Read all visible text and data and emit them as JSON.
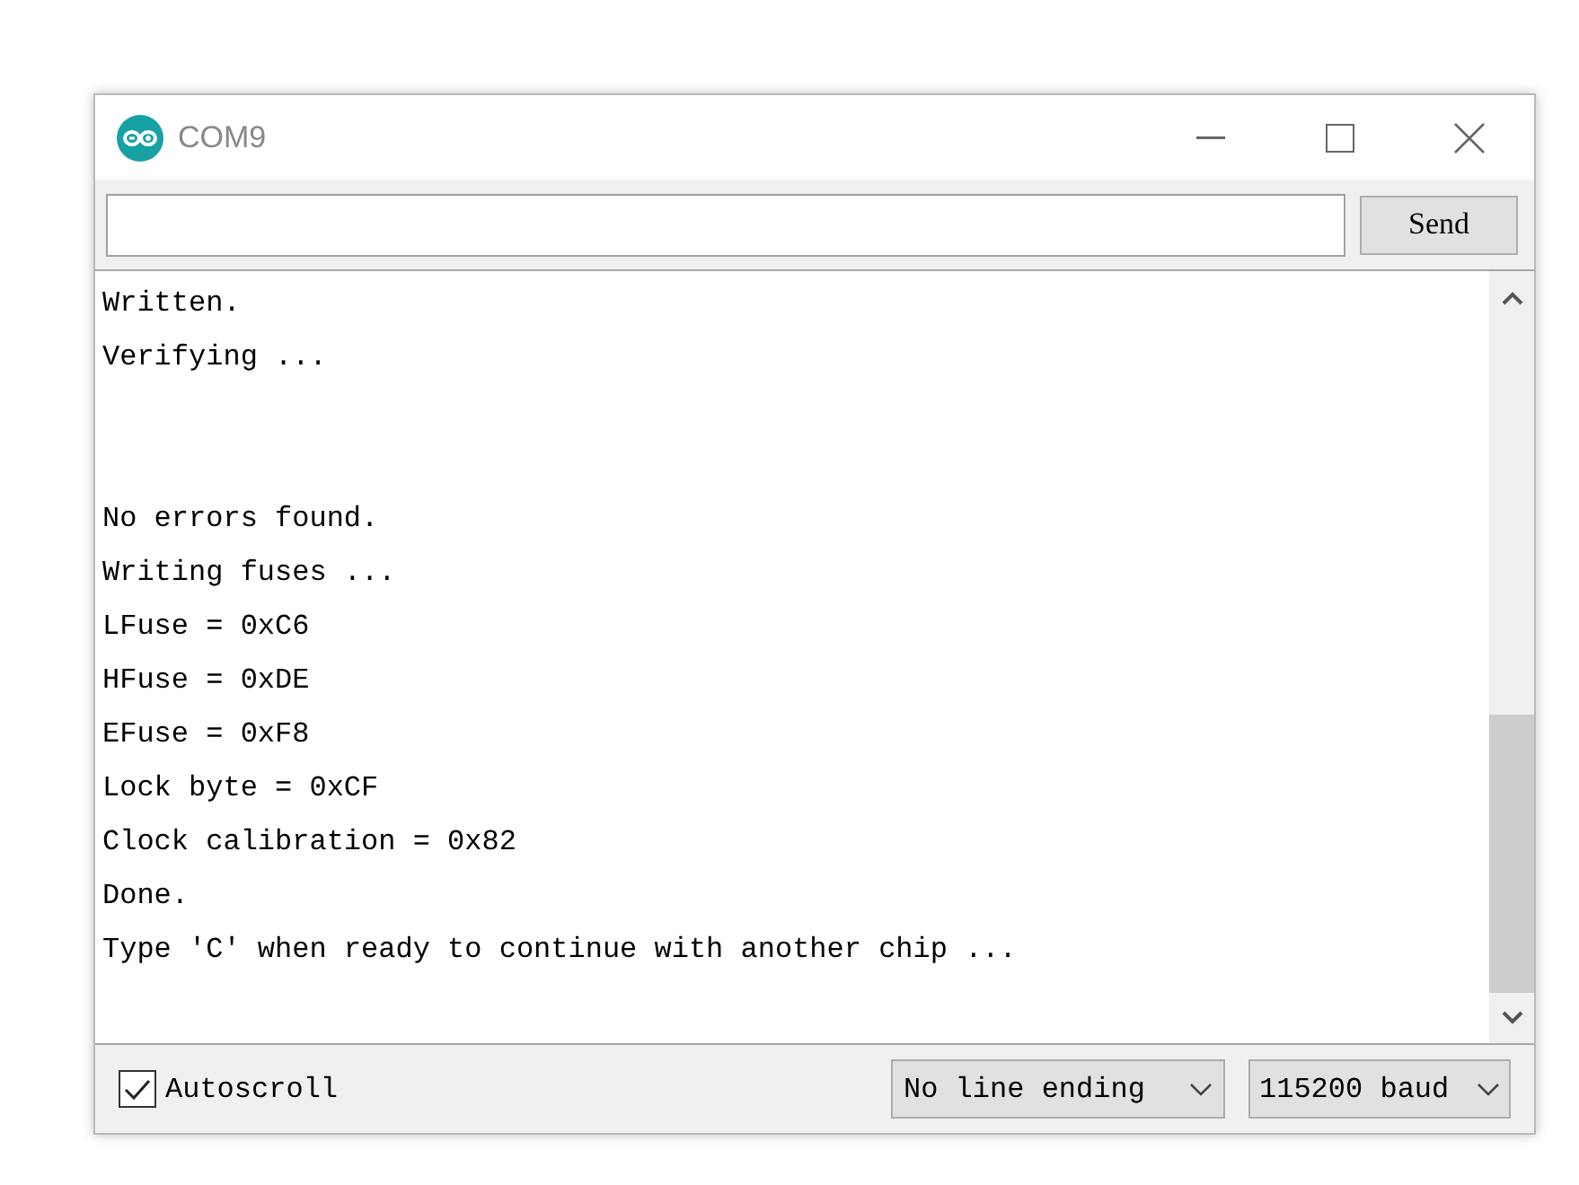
{
  "window": {
    "title": "COM9"
  },
  "send_button": {
    "label": "Send"
  },
  "output": {
    "blocks": [
      [
        "Written.",
        "Verifying ..."
      ],
      [
        "No errors found.",
        "Writing fuses ...",
        "LFuse = 0xC6",
        "HFuse = 0xDE",
        "EFuse = 0xF8",
        "Lock byte = 0xCF",
        "Clock calibration = 0x82",
        "Done.",
        "Type 'C' when ready to continue with another chip ..."
      ]
    ]
  },
  "footer": {
    "autoscroll": {
      "label": "Autoscroll",
      "checked": true
    },
    "line_ending": {
      "value": "No line ending"
    },
    "baud": {
      "value": "115200 baud"
    }
  }
}
